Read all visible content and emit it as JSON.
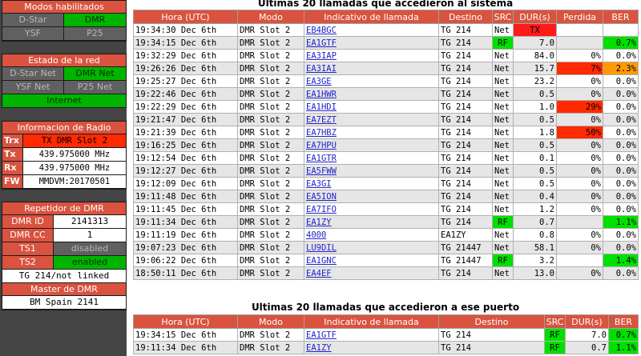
{
  "modes": {
    "title": "Modos habilitados",
    "items": [
      {
        "label": "D-Star",
        "state": "off"
      },
      {
        "label": "DMR",
        "state": "on"
      },
      {
        "label": "YSF",
        "state": "off"
      },
      {
        "label": "P25",
        "state": "off"
      }
    ]
  },
  "network": {
    "title": "Estado de la red",
    "items": [
      {
        "label": "D-Star Net",
        "state": "off"
      },
      {
        "label": "DMR Net",
        "state": "on"
      },
      {
        "label": "YSF Net",
        "state": "off"
      },
      {
        "label": "P25 Net",
        "state": "off"
      }
    ],
    "internet": "Internet"
  },
  "radio": {
    "title": "Informacion de Radio",
    "rows": [
      {
        "key": "Trx",
        "value": "TX DMR Slot 2"
      },
      {
        "key": "Tx",
        "value": "439.975000 MHz"
      },
      {
        "key": "Rx",
        "value": "439.975000 MHz"
      },
      {
        "key": "FW",
        "value": "MMDVM:20170501"
      }
    ]
  },
  "repeater": {
    "title": "Repetidor de DMR",
    "rows": [
      {
        "key": "DMR ID",
        "value": "2141313"
      },
      {
        "key": "DMR CC",
        "value": "1"
      },
      {
        "key": "TS1",
        "value": "disabled"
      },
      {
        "key": "TS2",
        "value": "enabled"
      }
    ],
    "tg_status": "TG 214/not linked",
    "master_title": "Master de DMR",
    "master": "BM Spain 2141"
  },
  "colors": {
    "header": "#d9533f",
    "green": "#00e000",
    "red": "#ff2a00",
    "orange": "#ff9900"
  },
  "system_calls": {
    "title": "Ultimas 20 llamadas que accedieron al sistema",
    "headers": [
      "Hora (UTC)",
      "Modo",
      "Indicativo de llamada",
      "Destino",
      "SRC",
      "DUR(s)",
      "Perdida",
      "BER"
    ],
    "rows": [
      [
        "19:34:30 Dec 6th",
        "DMR Slot 2",
        "EB4BGC",
        "TG 214",
        "Net",
        "TX",
        "",
        ""
      ],
      [
        "19:34:15 Dec 6th",
        "DMR Slot 2",
        "EA1GTF",
        "TG 214",
        "RF",
        "7.0",
        "",
        "0.7%"
      ],
      [
        "19:32:29 Dec 6th",
        "DMR Slot 2",
        "EA3IAP",
        "TG 214",
        "Net",
        "84.0",
        "0%",
        "0.0%"
      ],
      [
        "19:26:26 Dec 6th",
        "DMR Slot 2",
        "EA3IAI",
        "TG 214",
        "Net",
        "15.7",
        "7%",
        "2.3%"
      ],
      [
        "19:25:27 Dec 6th",
        "DMR Slot 2",
        "EA3GE",
        "TG 214",
        "Net",
        "23.2",
        "0%",
        "0.0%"
      ],
      [
        "19:22:46 Dec 6th",
        "DMR Slot 2",
        "EA1HWR",
        "TG 214",
        "Net",
        "0.5",
        "0%",
        "0.0%"
      ],
      [
        "19:22:29 Dec 6th",
        "DMR Slot 2",
        "EA1HDI",
        "TG 214",
        "Net",
        "1.0",
        "29%",
        "0.0%"
      ],
      [
        "19:21:47 Dec 6th",
        "DMR Slot 2",
        "EA7EZT",
        "TG 214",
        "Net",
        "0.5",
        "0%",
        "0.0%"
      ],
      [
        "19:21:39 Dec 6th",
        "DMR Slot 2",
        "EA7HBZ",
        "TG 214",
        "Net",
        "1.8",
        "50%",
        "0.0%"
      ],
      [
        "19:16:25 Dec 6th",
        "DMR Slot 2",
        "EA7HPU",
        "TG 214",
        "Net",
        "0.5",
        "0%",
        "0.0%"
      ],
      [
        "19:12:54 Dec 6th",
        "DMR Slot 2",
        "EA1GTR",
        "TG 214",
        "Net",
        "0.1",
        "0%",
        "0.0%"
      ],
      [
        "19:12:27 Dec 6th",
        "DMR Slot 2",
        "EA5FWW",
        "TG 214",
        "Net",
        "0.5",
        "0%",
        "0.0%"
      ],
      [
        "19:12:09 Dec 6th",
        "DMR Slot 2",
        "EA3GI",
        "TG 214",
        "Net",
        "0.5",
        "0%",
        "0.0%"
      ],
      [
        "19:11:48 Dec 6th",
        "DMR Slot 2",
        "EA5ION",
        "TG 214",
        "Net",
        "0.4",
        "0%",
        "0.0%"
      ],
      [
        "19:11:45 Dec 6th",
        "DMR Slot 2",
        "EA7IFO",
        "TG 214",
        "Net",
        "1.2",
        "0%",
        "0.0%"
      ],
      [
        "19:11:34 Dec 6th",
        "DMR Slot 2",
        "EA1ZY",
        "TG 214",
        "RF",
        "0.7",
        "",
        "1.1%"
      ],
      [
        "19:11:19 Dec 6th",
        "DMR Slot 2",
        "4000",
        "EA1ZY",
        "Net",
        "0.8",
        "0%",
        "0.0%"
      ],
      [
        "19:07:23 Dec 6th",
        "DMR Slot 2",
        "LU9DIL",
        "TG 21447",
        "Net",
        "58.1",
        "0%",
        "0.0%"
      ],
      [
        "19:06:22 Dec 6th",
        "DMR Slot 2",
        "EA1GNC",
        "TG 21447",
        "RF",
        "3.2",
        "",
        "1.4%"
      ],
      [
        "18:50:11 Dec 6th",
        "DMR Slot 2",
        "EA4EF",
        "TG 214",
        "Net",
        "13.0",
        "0%",
        "0.0%"
      ]
    ],
    "cell_colors": {
      "0-5": "tx",
      "1-4": "rf",
      "1-7": "grn",
      "3-6": "red",
      "3-7": "org",
      "6-6": "red",
      "8-6": "red",
      "15-4": "rf",
      "15-7": "grn",
      "18-4": "rf",
      "18-7": "grn"
    }
  },
  "port_calls": {
    "title": "Ultimas 20 llamadas que accedieron a ese puerto",
    "headers": [
      "Hora (UTC)",
      "Modo",
      "Indicativo de llamada",
      "Destino",
      "SRC",
      "DUR(s)",
      "BER"
    ],
    "rows": [
      [
        "19:34:15 Dec 6th",
        "DMR Slot 2",
        "EA1GTF",
        "TG 214",
        "RF",
        "7.0",
        "0.7%"
      ],
      [
        "19:11:34 Dec 6th",
        "DMR Slot 2",
        "EA1ZY",
        "TG 214",
        "RF",
        "0.7",
        "1.1%"
      ]
    ]
  }
}
